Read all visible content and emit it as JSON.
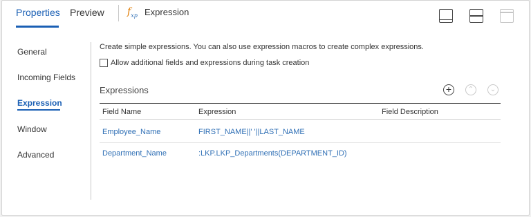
{
  "tabs": {
    "properties": "Properties",
    "preview": "Preview",
    "object_title": "Expression"
  },
  "icons": {
    "expression": "fx-icon",
    "layout_bottom": "panel-bottom-icon",
    "layout_split": "panel-split-icon",
    "layout_full": "panel-maximize-icon"
  },
  "nav": {
    "items": [
      {
        "label": "General"
      },
      {
        "label": "Incoming Fields"
      },
      {
        "label": "Expression"
      },
      {
        "label": "Window"
      },
      {
        "label": "Advanced"
      }
    ],
    "active_index": 2
  },
  "content": {
    "intro": "Create simple expressions. You can also use expression macros to create complex expressions.",
    "checkbox_label": "Allow additional fields and expressions during task creation",
    "checkbox_checked": false,
    "section_title": "Expressions",
    "columns": [
      "Field Name",
      "Expression",
      "Field Description"
    ],
    "rows": [
      {
        "field": "Employee_Name",
        "expression": "FIRST_NAME||' '||LAST_NAME",
        "description": ""
      },
      {
        "field": "Department_Name",
        "expression": ":LKP.LKP_Departments(DEPARTMENT_ID)",
        "description": ""
      }
    ]
  },
  "colors": {
    "accent": "#1a5fb4",
    "link": "#2f6fb5",
    "fx_orange": "#e07b00"
  }
}
